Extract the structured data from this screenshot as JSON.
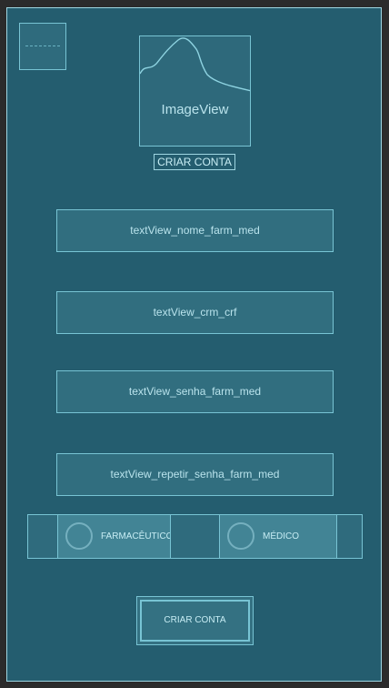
{
  "image_view": {
    "label": "ImageView"
  },
  "header": {
    "title": "CRIAR CONTA"
  },
  "fields": {
    "nome": "textView_nome_farm_med",
    "crm": "textView_crm_crf",
    "senha": "textView_senha_farm_med",
    "repetir_senha": "textView_repetir_senha_farm_med"
  },
  "profile_options": {
    "farmaceutico": "FARMACÊUTICO",
    "medico": "MÉDICO"
  },
  "submit": {
    "label": "CRIAR CONTA"
  },
  "colors": {
    "background": "#245d6f",
    "outline": "#78c4d4",
    "text": "#b9e3ec"
  }
}
